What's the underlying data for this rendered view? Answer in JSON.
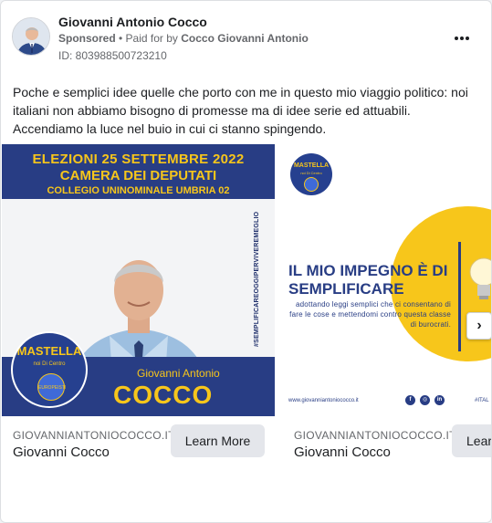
{
  "advertiser": {
    "name": "Giovanni Antonio Cocco",
    "sponsored": "Sponsored",
    "paid_for_prefix": " • Paid for by ",
    "paid_for_name": "Cocco Giovanni Antonio",
    "ad_id": "ID: 803988500723210"
  },
  "post": {
    "body": "Poche e semplici idee quelle che porto con me in questo mio viaggio politico: noi italiani non abbiamo bisogno di promesse ma di idee serie ed attuabili. Accendiamo la luce nel buio in cui ci stanno spingendo."
  },
  "carousel": {
    "cards": [
      {
        "headline_1": "ELEZIONI 25 SETTEMBRE 2022",
        "headline_2": "CAMERA DEI DEPUTATI",
        "headline_3": "COLLEGIO UNINOMINALE UMBRIA 02",
        "vertical_hashtag": "#SEMPLIFICAREOGGIPERVIVEREMEGLIO",
        "first_name": "Giovanni Antonio",
        "last_name": "COCCO",
        "logo_title": "MASTELLA",
        "logo_sub": "noi Di Centro",
        "logo_badge": "EUROPEISTI",
        "domain": "GIOVANNIANTONIOCOCCO.IT",
        "title": "Giovanni Cocco",
        "cta": "Learn More"
      },
      {
        "logo_title": "MASTELLA",
        "logo_sub": "noi Di Centro",
        "headline": "IL MIO IMPEGNO È DI SEMPLIFICARE",
        "description": "adottando leggi semplici che ci consentano di fare le cose e mettendomi contro questa classe di burocrati.",
        "footer_url": "www.giovanniantoniococco.it",
        "footer_tag": "#ITAL",
        "domain": "GIOVANNIANTONIOCOCCO.IT",
        "title": "Giovanni Cocco",
        "cta": "Lear"
      }
    ]
  },
  "icons": {
    "more": "more-horizontal-icon",
    "next": "chevron-right-icon",
    "facebook": "facebook-icon",
    "instagram": "instagram-icon",
    "linkedin": "linkedin-icon"
  },
  "colors": {
    "navy": "#283d84",
    "yellow": "#f7c61b",
    "button_bg": "#e4e6eb",
    "muted_text": "#65676b"
  }
}
